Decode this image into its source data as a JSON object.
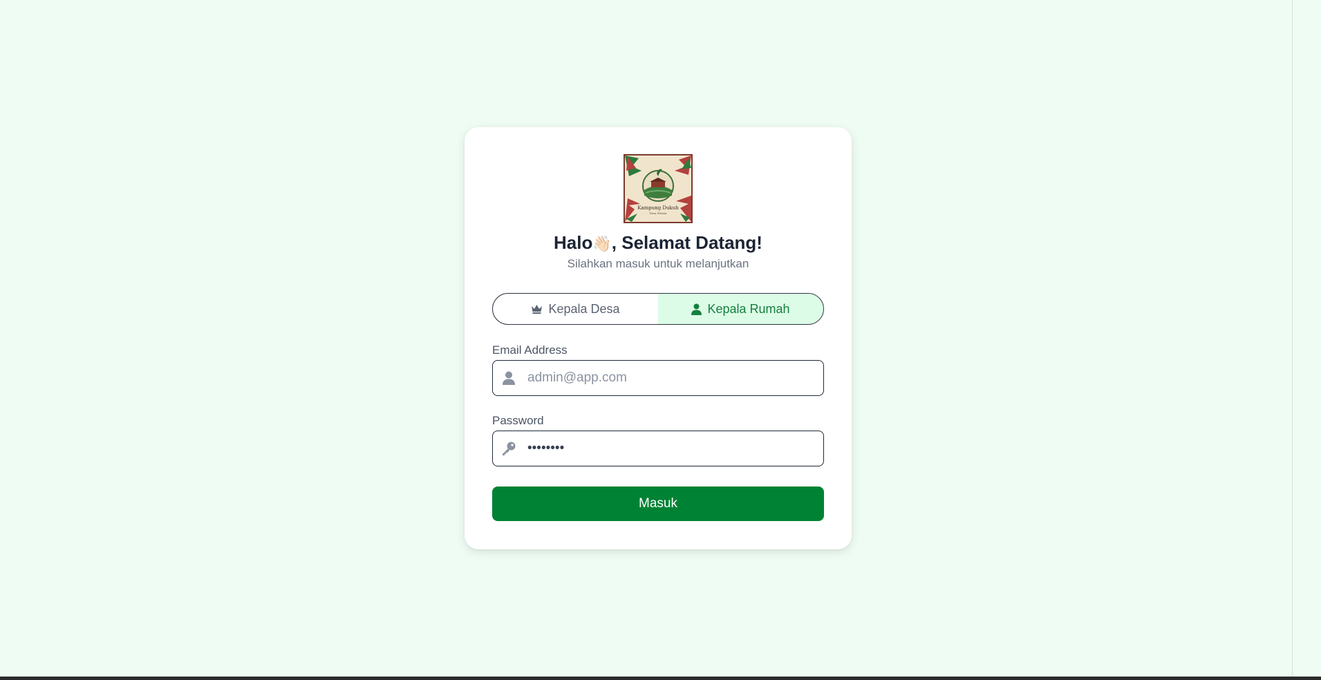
{
  "colors": {
    "page_background": "#effcf3",
    "card_background": "#ffffff",
    "primary_button": "#008234",
    "active_toggle_bg": "#dcfce7",
    "active_toggle_text": "#15803d"
  },
  "logo": {
    "text": "Kampung Dukuh",
    "subtext": "Desa Wisata"
  },
  "header": {
    "title_prefix": "Halo",
    "wave_emoji": "👋🏻",
    "title_suffix": ", Selamat Datang!",
    "subtitle": "Silahkan masuk untuk melanjutkan"
  },
  "role_toggle": {
    "options": [
      {
        "label": "Kepala Desa",
        "icon": "crown-icon",
        "active": false
      },
      {
        "label": "Kepala Rumah",
        "icon": "user-icon",
        "active": true
      }
    ]
  },
  "form": {
    "email": {
      "label": "Email Address",
      "placeholder": "admin@app.com",
      "value": "",
      "icon": "user-icon"
    },
    "password": {
      "label": "Password",
      "placeholder": "",
      "value": "12345678",
      "icon": "key-icon"
    },
    "submit_label": "Masuk"
  }
}
